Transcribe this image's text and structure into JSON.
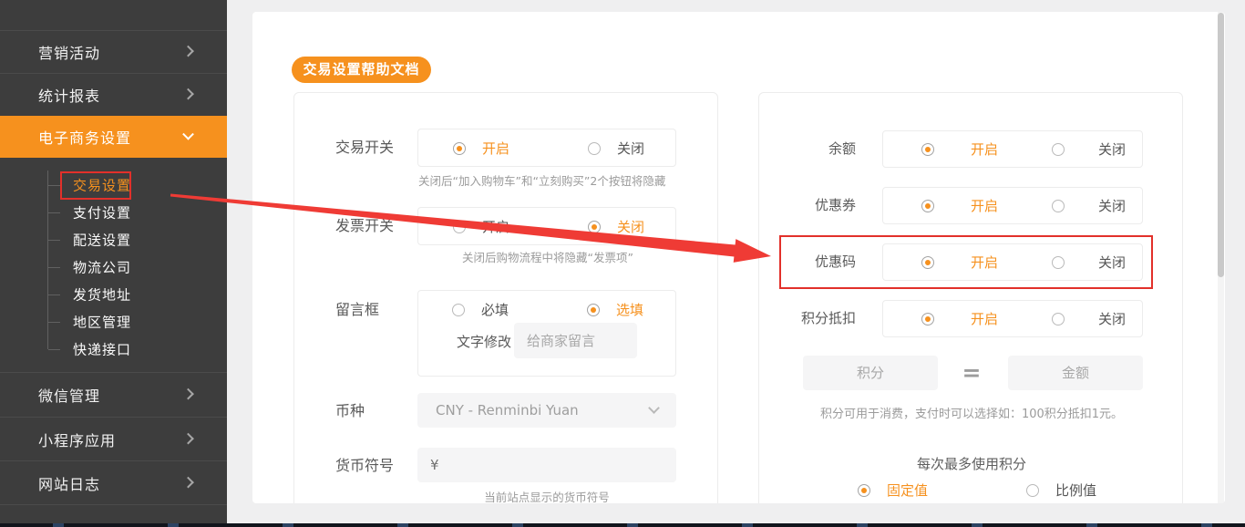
{
  "sidebar": {
    "items": [
      {
        "label": "营销活动"
      },
      {
        "label": "统计报表"
      },
      {
        "label": "电子商务设置"
      },
      {
        "label": "微信管理"
      },
      {
        "label": "小程序应用"
      },
      {
        "label": "网站日志"
      }
    ],
    "submenu": {
      "items": [
        "交易设置",
        "支付设置",
        "配送设置",
        "物流公司",
        "发货地址",
        "地区管理",
        "快递接口"
      ],
      "active_item": "交易设置"
    }
  },
  "toolbar": {
    "help_button_label": "交易设置帮助文档"
  },
  "left_panel": {
    "trade_switch": {
      "label": "交易开关",
      "on": "开启",
      "off": "关闭",
      "selected": "开启",
      "hint": "关闭后“加入购物车”和“立刻购买”2个按钮将隐藏"
    },
    "invoice_switch": {
      "label": "发票开关",
      "on": "开启",
      "off": "关闭",
      "selected": "关闭",
      "hint": "关闭后购物流程中将隐藏“发票项”"
    },
    "message_box": {
      "label": "留言框",
      "required": "必填",
      "optional": "选填",
      "selected": "选填",
      "edit_label": "文字修改",
      "edit_placeholder": "给商家留言"
    },
    "currency": {
      "label": "币种",
      "value": "CNY - Renminbi Yuan"
    },
    "currency_symbol": {
      "label": "货币符号",
      "value": "¥",
      "hint": "当前站点显示的货币符号"
    }
  },
  "right_panel": {
    "balance": {
      "label": "余额",
      "on": "开启",
      "off": "关闭",
      "selected": "开启"
    },
    "coupon": {
      "label": "优惠券",
      "on": "开启",
      "off": "关闭",
      "selected": "开启"
    },
    "coupon_code": {
      "label": "优惠码",
      "on": "开启",
      "off": "关闭",
      "selected": "开启"
    },
    "points_deduction": {
      "label": "积分抵扣",
      "on": "开启",
      "off": "关闭",
      "selected": "开启"
    },
    "points_exchange": {
      "points_placeholder": "积分",
      "equals": "=",
      "amount_placeholder": "金额",
      "hint": "积分可用于消费，支付时可以选择如：100积分抵扣1元。"
    },
    "max_points": {
      "title": "每次最多使用积分",
      "fixed": "固定值",
      "ratio": "比例值",
      "selected": "固定值"
    }
  },
  "colors": {
    "accent_orange": "#f6911e",
    "annotation_red": "#e2302a",
    "sidebar_bg": "#3d3d3d",
    "page_bg": "#efeff0"
  }
}
